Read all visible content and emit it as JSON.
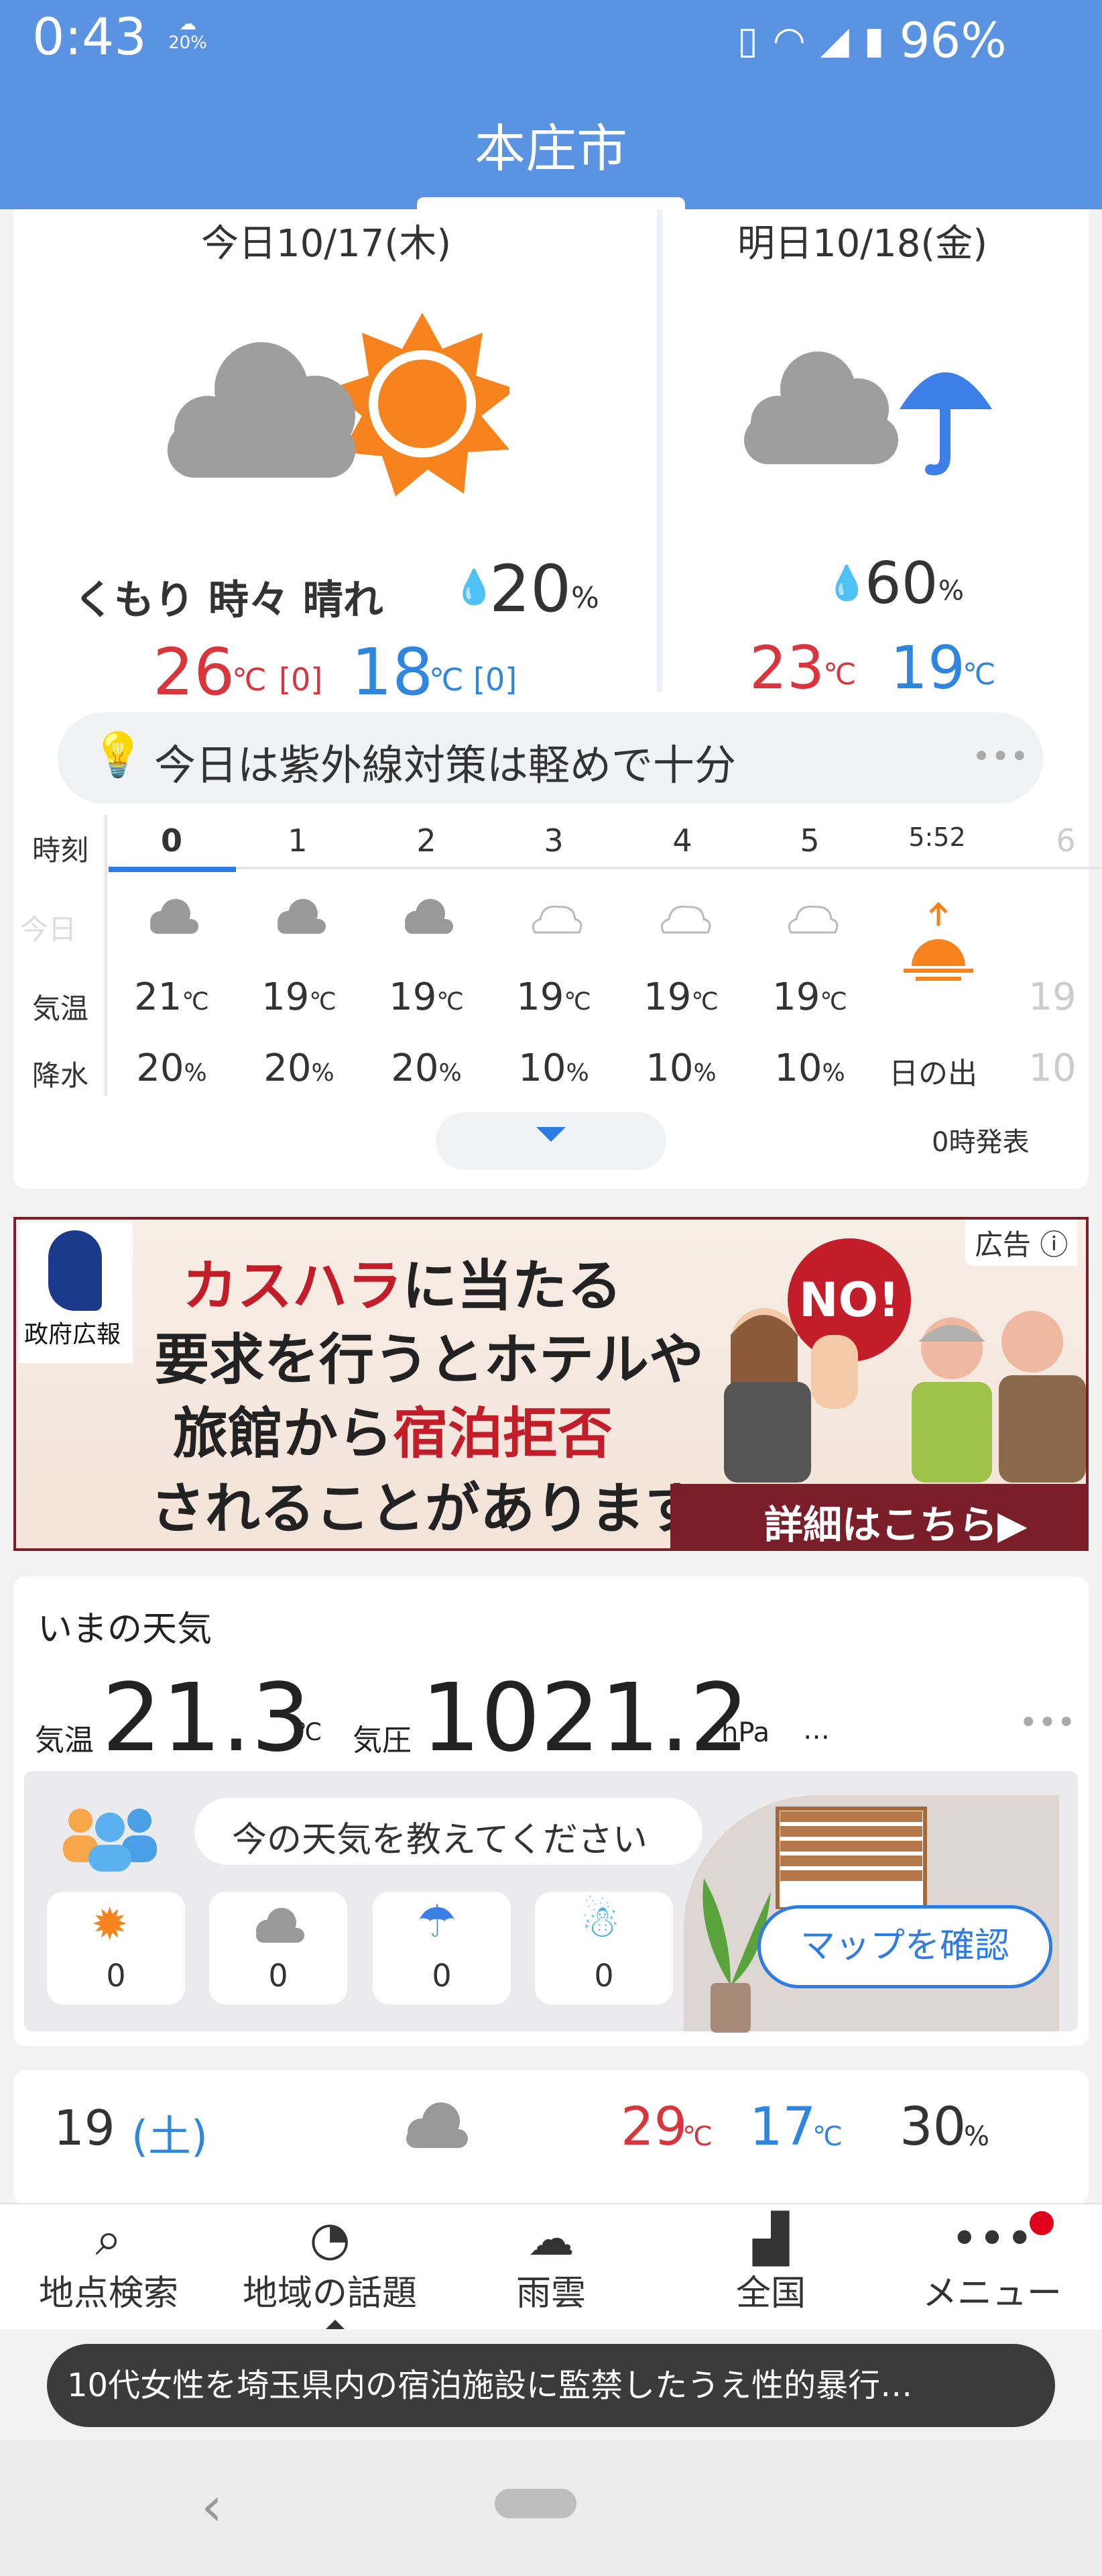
{
  "status_bar": {
    "time": "0:43",
    "weather_badge": "20%",
    "battery": "96%"
  },
  "header": {
    "title": "本庄市"
  },
  "today": {
    "label": "今日10/17(木)",
    "condition": "くもり 時々 晴れ",
    "precip": "20",
    "precip_unit": "%",
    "high": "26",
    "low": "18",
    "temp_unit": "℃",
    "high_diff": "[0]",
    "low_diff": "[0]"
  },
  "tomorrow": {
    "label": "明日10/18(金)",
    "precip": "60",
    "precip_unit": "%",
    "high": "23",
    "low": "19",
    "temp_unit": "℃"
  },
  "uv_advice": "今日は紫外線対策は軽めで十分",
  "hourly": {
    "row_labels": {
      "time": "時刻",
      "day": "今日",
      "temp": "気温",
      "rain": "降水"
    },
    "unit_c": "℃",
    "unit_pct": "%",
    "hours": [
      {
        "h": "0",
        "temp": "21",
        "rain": "20"
      },
      {
        "h": "1",
        "temp": "19",
        "rain": "20"
      },
      {
        "h": "2",
        "temp": "19",
        "rain": "20"
      },
      {
        "h": "3",
        "temp": "19",
        "rain": "10"
      },
      {
        "h": "4",
        "temp": "19",
        "rain": "10"
      },
      {
        "h": "5",
        "temp": "19",
        "rain": "10"
      }
    ],
    "sunrise": {
      "time": "5:52",
      "label": "日の出"
    },
    "partial": {
      "h": "6",
      "temp": "19",
      "rain": "10"
    },
    "issued": "0時発表"
  },
  "ad": {
    "label": "広告",
    "logo_text": "政府広報",
    "line1a": "カスハラ",
    "line1b": "に当たる",
    "line2": "要求を行うとホテルや",
    "line3a": "旅館から",
    "line3b": "宿泊拒否",
    "line4": "されることがあります。",
    "no_badge": "NO!",
    "cta": "詳細はこちら▶"
  },
  "now": {
    "title": "いまの天気",
    "temp_label": "気温",
    "temp": "21.3",
    "temp_unit": "℃",
    "pressure_label": "気圧",
    "pressure": "1021.2",
    "pressure_unit": "hPa",
    "ellipsis": "…",
    "prompt": "今の天気を教えてください",
    "report_counts": [
      "0",
      "0",
      "0",
      "0"
    ],
    "map_button": "マップを確認"
  },
  "next_day": {
    "date": "19",
    "weekday": "(土)",
    "high": "29",
    "low": "17",
    "temp_unit": "℃",
    "precip": "30",
    "precip_unit": "%"
  },
  "nav": [
    {
      "label": "地点検索"
    },
    {
      "label": "地域の話題"
    },
    {
      "label": "雨雲"
    },
    {
      "label": "全国"
    },
    {
      "label": "メニュー"
    }
  ],
  "toast": "10代女性を埼玉県内の宿泊施設に監禁したうえ性的暴行…",
  "colors": {
    "brand_blue": "#5b93e3",
    "temp_red": "#d8353c",
    "temp_blue": "#2e86de",
    "sun_orange": "#f7831e"
  }
}
